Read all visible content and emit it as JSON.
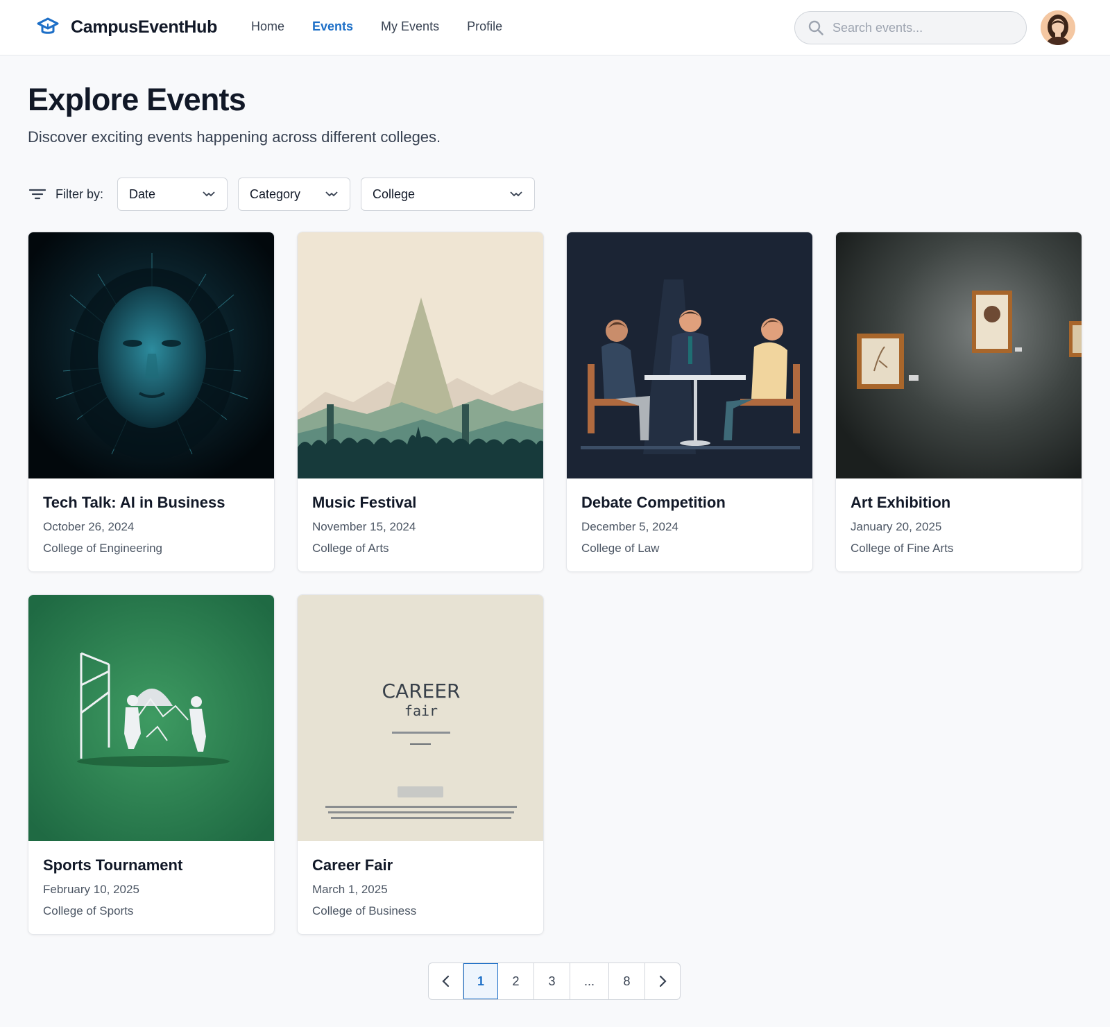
{
  "header": {
    "brand_name": "CampusEventHub",
    "nav": [
      {
        "label": "Home",
        "active": false
      },
      {
        "label": "Events",
        "active": true
      },
      {
        "label": "My Events",
        "active": false
      },
      {
        "label": "Profile",
        "active": false
      }
    ],
    "search_placeholder": "Search events...",
    "accent_color": "#1d6fc7"
  },
  "main": {
    "title": "Explore Events",
    "subtitle": "Discover exciting events happening across different colleges."
  },
  "filters": {
    "label": "Filter by:",
    "selects": [
      {
        "value": "Date"
      },
      {
        "value": "Category"
      },
      {
        "value": "College"
      }
    ]
  },
  "events": [
    {
      "title": "Tech Talk: AI in Business",
      "date": "October 26, 2024",
      "college": "College of Engineering",
      "image": "ai-face-illustration"
    },
    {
      "title": "Music Festival",
      "date": "November 15, 2024",
      "college": "College of Arts",
      "image": "concert-crowd-illustration"
    },
    {
      "title": "Debate Competition",
      "date": "December 5, 2024",
      "college": "College of Law",
      "image": "debate-table-illustration"
    },
    {
      "title": "Art Exhibition",
      "date": "January 20, 2025",
      "college": "College of Fine Arts",
      "image": "gallery-frames-photo"
    },
    {
      "title": "Sports Tournament",
      "date": "February 10, 2025",
      "college": "College of Sports",
      "image": "sports-figures-illustration"
    },
    {
      "title": "Career Fair",
      "date": "March 1, 2025",
      "college": "College of Business",
      "image": "career-fair-poster"
    }
  ],
  "career_poster": {
    "line1": "CAREER",
    "line2": "fair"
  },
  "pagination": {
    "pages": [
      "1",
      "2",
      "3",
      "...",
      "8"
    ],
    "current": "1"
  }
}
